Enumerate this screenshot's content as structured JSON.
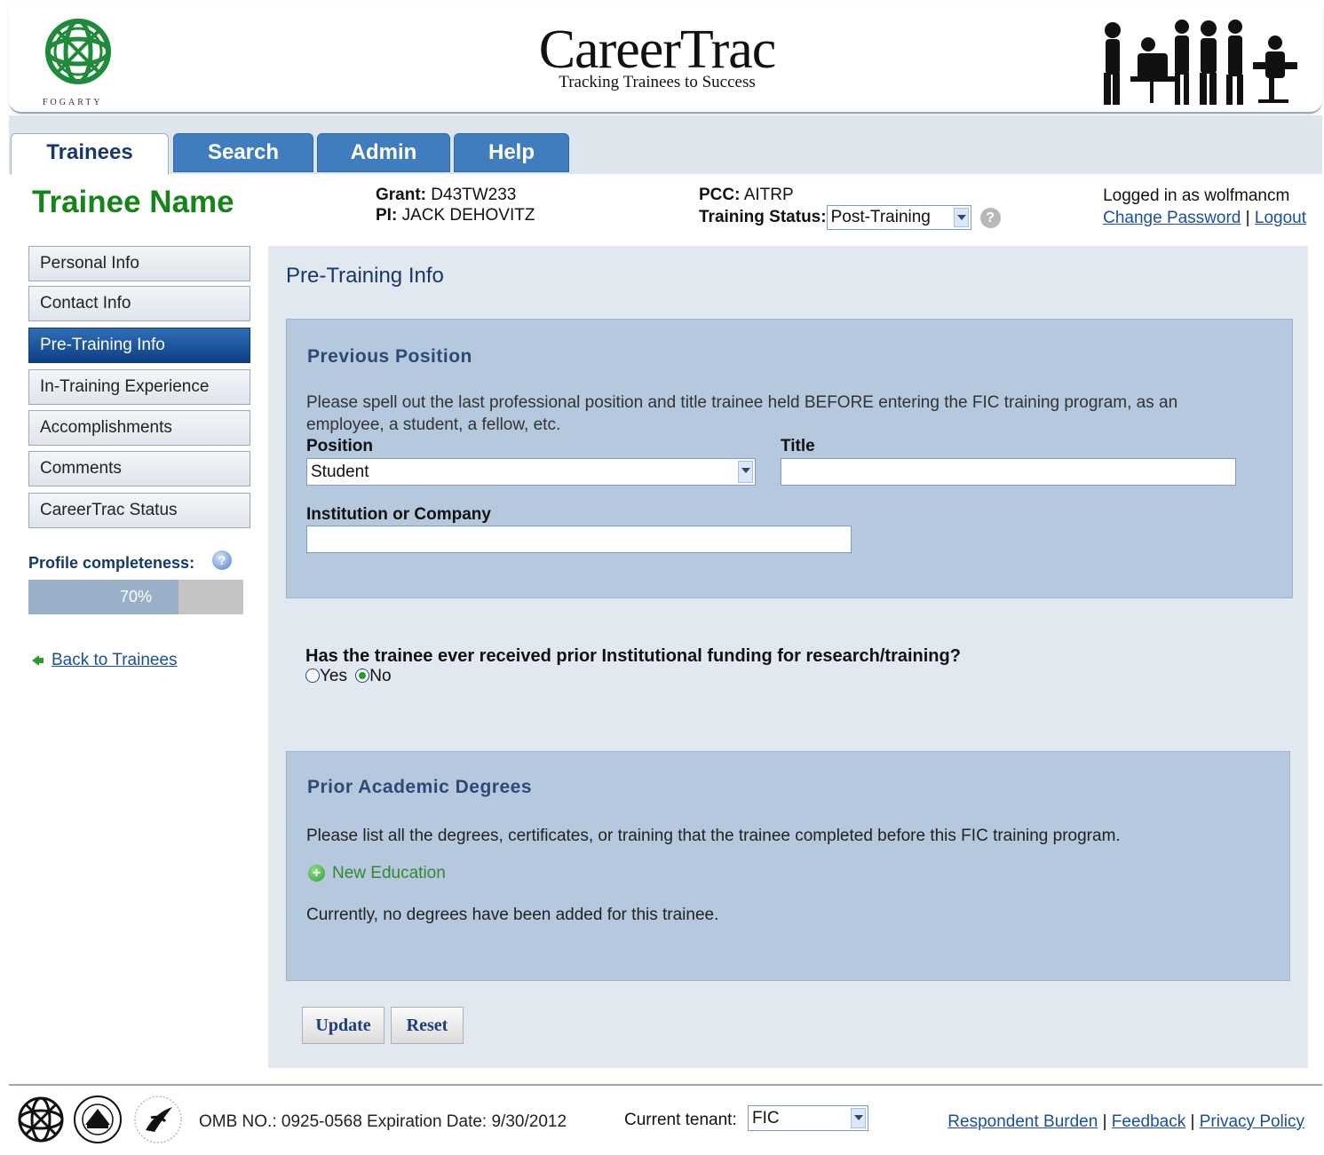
{
  "header": {
    "logo_text": "FOGARTY",
    "brand_title": "CareerTrac",
    "brand_tagline": "Tracking Trainees to Success"
  },
  "tabs": [
    {
      "label": "Trainees",
      "active": true
    },
    {
      "label": "Search",
      "active": false
    },
    {
      "label": "Admin",
      "active": false
    },
    {
      "label": "Help",
      "active": false
    }
  ],
  "trainee": {
    "name": "Trainee Name",
    "grant_label": "Grant:",
    "grant_value": "D43TW233",
    "pi_label": "PI:",
    "pi_value": "JACK DEHOVITZ",
    "pcc_label": "PCC:",
    "pcc_value": "AITRP",
    "status_label": "Training Status:",
    "status_value": "Post-Training"
  },
  "login": {
    "logged_in_text": "Logged in as wolfmancm",
    "change_password": "Change Password",
    "separator": "|",
    "logout": "Logout"
  },
  "nav": {
    "items": [
      {
        "label": "Personal Info",
        "active": false
      },
      {
        "label": "Contact Info",
        "active": false
      },
      {
        "label": "Pre-Training Info",
        "active": true
      },
      {
        "label": "In-Training Experience",
        "active": false
      },
      {
        "label": "Accomplishments",
        "active": false
      },
      {
        "label": "Comments",
        "active": false
      },
      {
        "label": "CareerTrac Status",
        "active": false
      }
    ],
    "profile_label": "Profile completeness:",
    "profile_percent_text": "70%",
    "profile_fraction": 0.7,
    "back_link": "Back to Trainees"
  },
  "content": {
    "title": "Pre-Training Info",
    "previous_position": {
      "title": "Previous Position",
      "instructions": "Please spell out the last professional position and title trainee held BEFORE entering the FIC training program, as an employee, a student, a fellow, etc.",
      "position_label": "Position",
      "position_value": "Student",
      "title_label": "Title",
      "title_value": "",
      "institution_label": "Institution or Company",
      "institution_value": ""
    },
    "funding": {
      "question": "Has the trainee ever received prior Institutional funding for research/training?",
      "yes_label": "Yes",
      "no_label": "No",
      "selected": "No"
    },
    "degrees": {
      "title": "Prior Academic Degrees",
      "instructions": "Please list all the degrees, certificates, or training that the trainee completed before this FIC training program.",
      "new_link": "New Education",
      "empty_text": "Currently, no degrees have been added for this trainee."
    },
    "buttons": {
      "update": "Update",
      "reset": "Reset"
    }
  },
  "footer": {
    "omb_text": "OMB NO.: 0925-0568 Expiration Date: 9/30/2012",
    "tenant_label": "Current tenant:",
    "tenant_value": "FIC",
    "links": [
      "Respondent Burden",
      "Feedback",
      "Privacy Policy"
    ],
    "separator": "|"
  },
  "colors": {
    "accent": "#3f7dbf",
    "trainee_name": "#168418",
    "panel": "#b5c8de",
    "content_bg": "#e2e8ef",
    "nav_active": "#0e3f85"
  }
}
